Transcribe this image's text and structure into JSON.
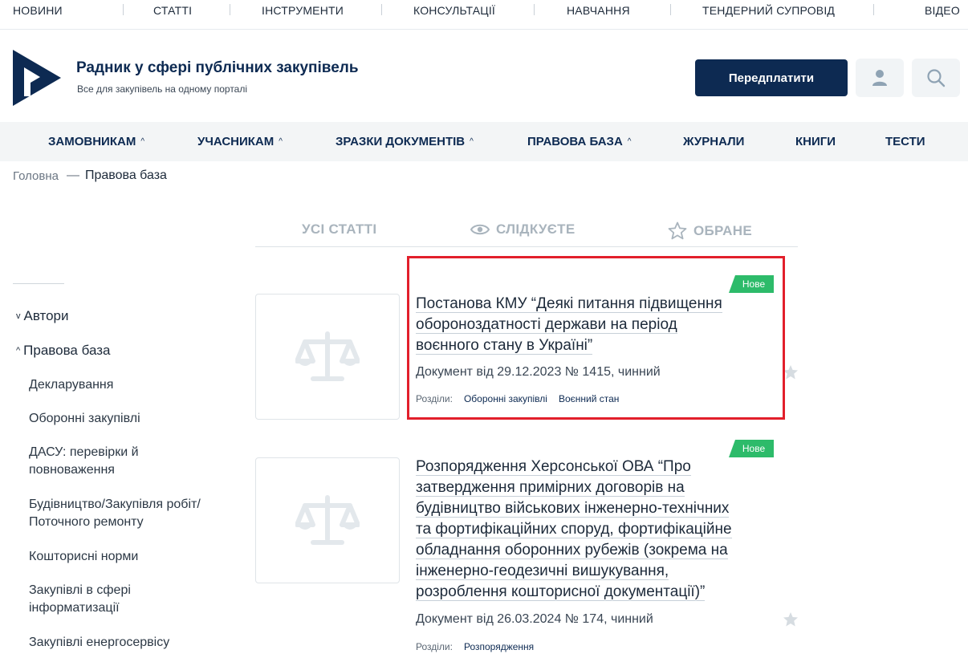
{
  "topnav": {
    "items": [
      "Новини",
      "Статті",
      "Інструменти",
      "Консультації",
      "Навчання",
      "Тендерний супровід",
      "Відео"
    ]
  },
  "header": {
    "title": "Радник у сфері публічних закупівель",
    "subtitle": "Все для закупівель на одному порталі",
    "subscribe_label": "Передплатити",
    "user_icon": "user-icon",
    "search_icon": "search-icon",
    "brand_color": "#0d2a52"
  },
  "mainnav": {
    "items": [
      {
        "label": "ЗАМОВНИКАМ",
        "has_dropdown": true
      },
      {
        "label": "УЧАСНИКАМ",
        "has_dropdown": true
      },
      {
        "label": "ЗРАЗКИ ДОКУМЕНТІВ",
        "has_dropdown": true
      },
      {
        "label": "ПРАВОВА БАЗА",
        "has_dropdown": true
      },
      {
        "label": "ЖУРНАЛИ",
        "has_dropdown": false
      },
      {
        "label": "КНИГИ",
        "has_dropdown": false
      },
      {
        "label": "ТЕСТИ",
        "has_dropdown": false
      }
    ]
  },
  "breadcrumb": {
    "home": "Головна",
    "separator": "—",
    "current": "Правова база"
  },
  "tabs": {
    "all": "УСІ СТАТТІ",
    "following": "СЛІДКУЄТЕ",
    "favorites": "ОБРАНЕ"
  },
  "sidebar": {
    "authors": "Автори",
    "legal_base": "Правова база",
    "items": [
      "Декларування",
      "Оборонні закупівлі",
      "ДАСУ: перевірки й повноваження",
      "Будівництво/Закупівля робіт/ Поточного ремонту",
      "Кошторисні норми",
      "Закупівлі в сфері інформатизації",
      "Закупівлі енергосервісу"
    ]
  },
  "documents": [
    {
      "badge": "Нове",
      "title": "Постанова КМУ “Деякі питання підвищення обороноздатності держави на період воєнного стану в Україні”",
      "title_lines": [
        "Постанова КМУ “Деякі питання підвищення",
        "обороноздатності держави на період",
        "воєнного стану в Україні”"
      ],
      "meta": "Документ від 29.12.2023 № 1415, чинний",
      "sections_label": "Розділи:",
      "sections": [
        "Оборонні закупівлі",
        "Воєнний стан"
      ]
    },
    {
      "badge": "Нове",
      "title": "Розпорядження Херсонської ОВА “Про затвердження примірних договорів на будівництво військових інженерно-технічних та фортифікаційних споруд, фортифікаційне обладнання оборонних рубежів (зокрема на інженерно-геодезичні вишукування, розроблення кошторисної документації)”",
      "title_lines": [
        "Розпорядження Херсонської ОВА “Про",
        "затвердження примірних договорів на",
        "будівництво військових інженерно-технічних",
        "та фортифікаційних споруд, фортифікаційне",
        "обладнання оборонних рубежів (зокрема на",
        "інженерно-геодезичні вишукування,",
        "розроблення кошторисної документації)”"
      ],
      "meta": "Документ від 26.03.2024 № 174, чинний",
      "sections_label": "Розділи:",
      "sections": [
        "Розпорядження"
      ]
    }
  ],
  "colors": {
    "accent": "#0d2a52",
    "badge": "#2dbb6a",
    "highlight": "#e21f2b"
  }
}
